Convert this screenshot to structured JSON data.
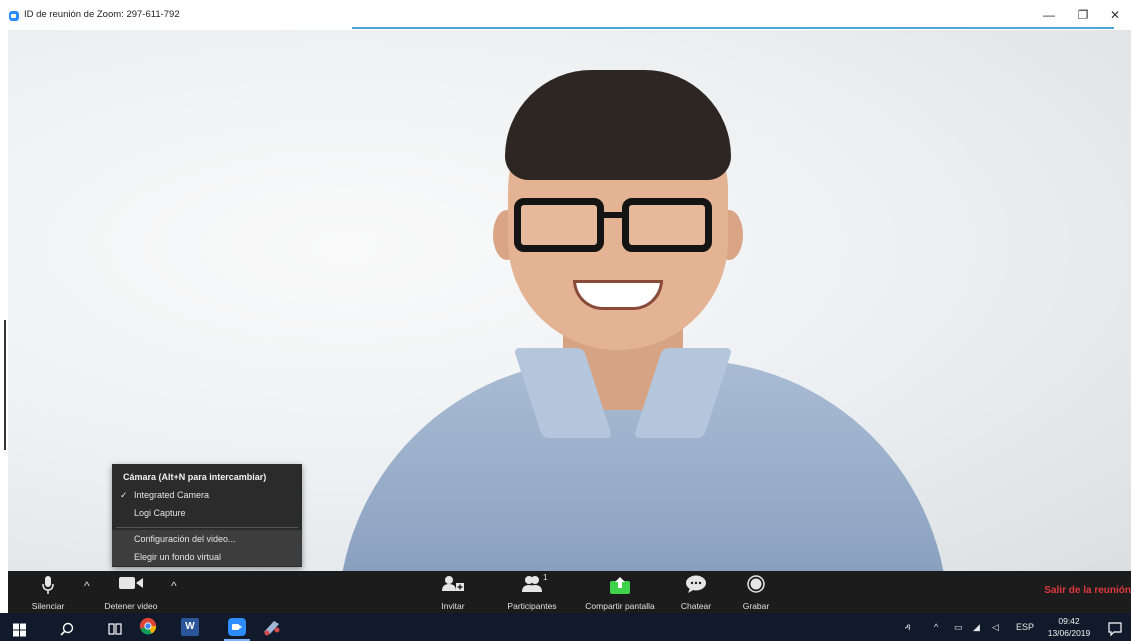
{
  "window": {
    "title": "ID de reunión de Zoom: 297-611-792",
    "minimize_glyph": "—",
    "maximize_glyph": "❐",
    "close_glyph": "✕"
  },
  "camera_menu": {
    "header": "Cámara (Alt+N para intercambiar)",
    "items": [
      {
        "label": "Integrated Camera",
        "checked": true
      },
      {
        "label": "Logi Capture",
        "checked": false
      },
      {
        "label": "Configuración del video...",
        "checked": false
      },
      {
        "label": "Elegir un fondo virtual",
        "checked": false
      }
    ],
    "check_glyph": "✓"
  },
  "controls": {
    "mute_label": "Silenciar",
    "video_label": "Detener video",
    "invite_label": "Invitar",
    "participants_label": "Participantes",
    "participants_count": "1",
    "share_label": "Compartir pantalla",
    "chat_label": "Chatear",
    "record_label": "Grabar",
    "leave_label": "Salir de la reunión",
    "caret_glyph": "^"
  },
  "taskbar": {
    "language": "ESP",
    "time": "09:42",
    "date": "13/06/2019",
    "word_glyph": "W"
  },
  "colors": {
    "zoom_blue": "#2D8CFF",
    "share_green": "#3fd24a",
    "leave_red": "#e0383e",
    "control_bar": "#1c1c1c",
    "taskbar": "#111a2b"
  }
}
